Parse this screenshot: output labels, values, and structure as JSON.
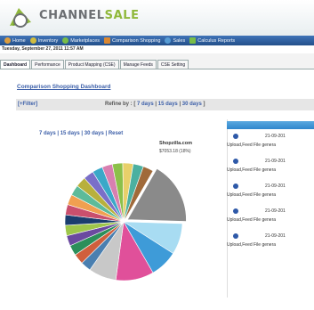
{
  "brand": {
    "name_part1": "CHANNEL",
    "name_part2": "SALE"
  },
  "nav": [
    {
      "label": "Home",
      "color": "#e6a13a"
    },
    {
      "label": "Inventory",
      "color": "#d9c23b"
    },
    {
      "label": "Marketplaces",
      "color": "#7cc243"
    },
    {
      "label": "Comparison Shopping",
      "color": "#e38a2d"
    },
    {
      "label": "Sales",
      "color": "#5aa0d8"
    },
    {
      "label": "Calculus Reports",
      "color": "#7cc243"
    }
  ],
  "datetime": "Tuesday, September 27, 2011 11:57 AM",
  "tabs": [
    {
      "label": "Dashboard",
      "active": true
    },
    {
      "label": "Performance",
      "active": false
    },
    {
      "label": "Product Mapping (CSE)",
      "active": false
    },
    {
      "label": "Manage Feeds",
      "active": false
    },
    {
      "label": "CSE Setting",
      "active": false
    }
  ],
  "page_title": "Comparison Shopping Dashboard",
  "filter": {
    "filter_label": "[+Filter]",
    "refine_label": "Refine by : [",
    "options": [
      "7 days",
      "15 days",
      "30 days"
    ],
    "sep": "|",
    "close": "]"
  },
  "chart_controls": {
    "d7": "7 days",
    "d15": "15 days",
    "d30": "30 days",
    "reset": "Reset",
    "sep": "|"
  },
  "highlight": {
    "name": "Shopzilla.com",
    "value": "$7053.18 (18%)"
  },
  "notifications": [
    {
      "date": "21-09-201",
      "text": "Upload,Feed File genera"
    },
    {
      "date": "21-09-201",
      "text": "Upload,Feed File genera"
    },
    {
      "date": "21-09-201",
      "text": "Upload,Feed File genera"
    },
    {
      "date": "21-09-201",
      "text": "Upload,Feed File genera"
    },
    {
      "date": "21-09-201",
      "text": "Upload,Feed File genera"
    }
  ],
  "chart_data": {
    "type": "pie",
    "title": "",
    "slices": [
      {
        "label": "Shopzilla.com",
        "value": 18,
        "color": "#8a8a8a"
      },
      {
        "label": "",
        "value": 9,
        "color": "#a8dcf2"
      },
      {
        "label": "",
        "value": 8,
        "color": "#3e9bd8"
      },
      {
        "label": "",
        "value": 11,
        "color": "#e0509a"
      },
      {
        "label": "",
        "value": 8,
        "color": "#c8c8c8"
      },
      {
        "label": "",
        "value": 3,
        "color": "#4a7fb0"
      },
      {
        "label": "",
        "value": 3,
        "color": "#d05f3c"
      },
      {
        "label": "",
        "value": 3,
        "color": "#2c8f5a"
      },
      {
        "label": "",
        "value": 3,
        "color": "#6b4aa0"
      },
      {
        "label": "",
        "value": 3,
        "color": "#9ec64a"
      },
      {
        "label": "",
        "value": 3,
        "color": "#1a3d6e"
      },
      {
        "label": "",
        "value": 3,
        "color": "#c94f6d"
      },
      {
        "label": "",
        "value": 3,
        "color": "#f0a050"
      },
      {
        "label": "",
        "value": 3,
        "color": "#5dbb9a"
      },
      {
        "label": "",
        "value": 3,
        "color": "#b8b03c"
      },
      {
        "label": "",
        "value": 3,
        "color": "#7a6fc8"
      },
      {
        "label": "",
        "value": 3,
        "color": "#3aa8c8"
      },
      {
        "label": "",
        "value": 3,
        "color": "#d87fb0"
      },
      {
        "label": "",
        "value": 3,
        "color": "#8cc04a"
      },
      {
        "label": "",
        "value": 3,
        "color": "#e8d06a"
      },
      {
        "label": "",
        "value": 3,
        "color": "#4cb0a0"
      },
      {
        "label": "",
        "value": 3,
        "color": "#a06a3a"
      }
    ]
  }
}
